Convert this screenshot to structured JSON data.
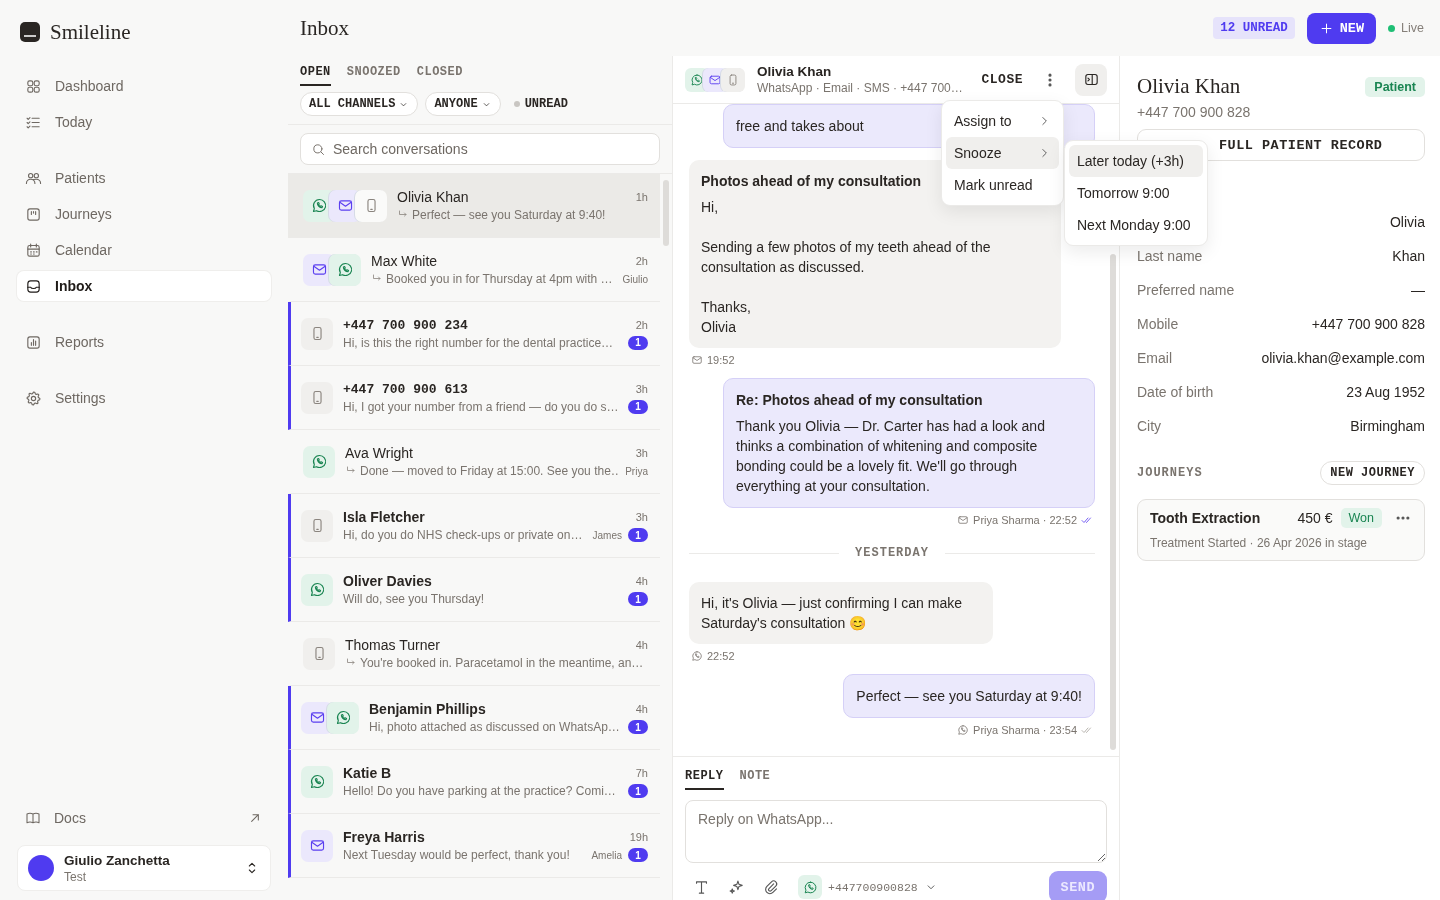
{
  "sidebar": {
    "brand": "Smileline",
    "nav_groups": [
      {
        "items": [
          {
            "label": "Dashboard",
            "selected": false
          },
          {
            "label": "Today",
            "selected": false
          }
        ]
      },
      {
        "items": [
          {
            "label": "Patients",
            "selected": false
          },
          {
            "label": "Journeys",
            "selected": false
          },
          {
            "label": "Calendar",
            "selected": false
          },
          {
            "label": "Inbox",
            "selected": true
          }
        ]
      },
      {
        "items": [
          {
            "label": "Reports",
            "selected": false
          }
        ]
      },
      {
        "items": [
          {
            "label": "Settings",
            "selected": false
          }
        ]
      }
    ],
    "docs": "Docs",
    "user": {
      "name": "Giulio Zanchetta",
      "workspace": "Test"
    }
  },
  "header": {
    "title": "Inbox",
    "unread_badge": "12 UNREAD",
    "new_button": "NEW",
    "status": "Live"
  },
  "list": {
    "tabs": [
      {
        "label": "OPEN",
        "selected": true
      },
      {
        "label": "SNOOZED",
        "selected": false
      },
      {
        "label": "CLOSED",
        "selected": false
      }
    ],
    "filters": [
      {
        "label": "ALL CHANNELS",
        "kind": "dropdown"
      },
      {
        "label": "ANYONE",
        "kind": "dropdown"
      },
      {
        "label": "UNREAD",
        "kind": "toggle",
        "on": false
      }
    ],
    "search": {
      "placeholder": "Search conversations"
    },
    "conversations": [
      {
        "channels": [
          {
            "kind": "whatsapp"
          },
          {
            "kind": "email"
          },
          {
            "kind": "sms"
          }
        ],
        "name": "Olivia Khan",
        "phone_name": false,
        "replied": true,
        "preview": "Perfect — see you Saturday at 9:40!",
        "time": "1h",
        "unread": false,
        "selected": true
      },
      {
        "channels": [
          {
            "kind": "email"
          },
          {
            "kind": "whatsapp"
          }
        ],
        "name": "Max White",
        "phone_name": false,
        "replied": true,
        "preview": "Booked you in for Thursday at 4pm with …",
        "time": "2h",
        "assignee": "Giulio",
        "unread": false,
        "selected": false
      },
      {
        "channels": [
          {
            "kind": "sms"
          }
        ],
        "name": "+447 700 900 234",
        "phone_name": true,
        "replied": false,
        "preview": "Hi, is this the right number for the dental practice…",
        "time": "2h",
        "unread_count": "1",
        "unread": true,
        "selected": false
      },
      {
        "channels": [
          {
            "kind": "sms"
          }
        ],
        "name": "+447 700 900 613",
        "phone_name": true,
        "replied": false,
        "preview": "Hi, I got your number from a friend — do you do s…",
        "time": "3h",
        "unread_count": "1",
        "unread": true,
        "selected": false
      },
      {
        "channels": [
          {
            "kind": "whatsapp"
          }
        ],
        "name": "Ava Wright",
        "phone_name": false,
        "replied": true,
        "preview": "Done — moved to Friday at 15:00. See you the…",
        "time": "3h",
        "assignee": "Priya",
        "unread": false,
        "selected": false
      },
      {
        "channels": [
          {
            "kind": "sms"
          }
        ],
        "name": "Isla Fletcher",
        "phone_name": false,
        "replied": false,
        "preview": "Hi, do you do NHS check-ups or private on…",
        "time": "3h",
        "assignee": "James",
        "unread_count": "1",
        "unread": true,
        "selected": false
      },
      {
        "channels": [
          {
            "kind": "whatsapp"
          }
        ],
        "name": "Oliver Davies",
        "phone_name": false,
        "replied": false,
        "preview": "Will do, see you Thursday!",
        "time": "4h",
        "unread_count": "1",
        "unread": true,
        "selected": false
      },
      {
        "channels": [
          {
            "kind": "sms"
          }
        ],
        "name": "Thomas Turner",
        "phone_name": false,
        "replied": true,
        "preview": "You're booked in. Paracetamol in the meantime, an…",
        "time": "4h",
        "unread": false,
        "selected": false
      },
      {
        "channels": [
          {
            "kind": "email"
          },
          {
            "kind": "whatsapp"
          }
        ],
        "name": "Benjamin Phillips",
        "phone_name": false,
        "replied": false,
        "preview": "Hi, photo attached as discussed on WhatsAp…",
        "time": "4h",
        "unread_count": "1",
        "unread": true,
        "selected": false
      },
      {
        "channels": [
          {
            "kind": "whatsapp"
          }
        ],
        "name": "Katie B",
        "phone_name": false,
        "replied": false,
        "preview": "Hello! Do you have parking at the practice? Comi…",
        "time": "7h",
        "unread_count": "1",
        "unread": true,
        "selected": false
      },
      {
        "channels": [
          {
            "kind": "email"
          }
        ],
        "name": "Freya Harris",
        "phone_name": false,
        "replied": false,
        "preview": "Next Tuesday would be perfect, thank you!",
        "time": "19h",
        "assignee": "Amelia",
        "unread_count": "1",
        "unread": true,
        "selected": false
      }
    ]
  },
  "chat": {
    "channels": [
      {
        "kind": "whatsapp"
      },
      {
        "kind": "email"
      },
      {
        "kind": "sms"
      }
    ],
    "name": "Olivia Khan",
    "subtitle": "WhatsApp · Email · SMS · +447 700…",
    "close_button": "CLOSE",
    "messages": [
      {
        "kind": "out",
        "channel": {
          "kind": "email"
        },
        "body": "free and takes about"
      },
      {
        "kind": "in",
        "channel": {
          "kind": "email"
        },
        "subject": "Photos ahead of my consultation",
        "body": "Hi,\n\nSending a few photos of my teeth ahead of the consultation as discussed.\n\nThanks,\nOlivia",
        "meta": "19:52"
      },
      {
        "kind": "out",
        "channel": {
          "kind": "email"
        },
        "subject": "Re: Photos ahead of my consultation",
        "body": "Thank you Olivia — Dr. Carter has had a look and thinks a combination of whitening and composite bonding could be a lovely fit. We'll go through everything at your consultation.",
        "meta": "Priya Sharma · 22:52",
        "read": true
      },
      {
        "kind": "divider",
        "label": "YESTERDAY"
      },
      {
        "kind": "in",
        "channel": {
          "kind": "whatsapp"
        },
        "body": "Hi, it's Olivia — just confirming I can make Saturday's consultation 😊",
        "meta": "22:52"
      },
      {
        "kind": "out",
        "channel": {
          "kind": "whatsapp"
        },
        "body": "Perfect — see you Saturday at 9:40!",
        "meta": "Priya Sharma · 23:54",
        "read": false
      }
    ],
    "composer": {
      "tabs": [
        {
          "label": "REPLY",
          "selected": true
        },
        {
          "label": "NOTE",
          "selected": false
        }
      ],
      "placeholder": "Reply on WhatsApp...",
      "sender": "+447700900828",
      "send_button": "SEND",
      "send_disabled": true
    }
  },
  "context_menu": {
    "items": [
      {
        "label": "Assign to",
        "submenu": true,
        "selected": false
      },
      {
        "label": "Snooze",
        "submenu": true,
        "selected": true
      },
      {
        "label": "Mark unread",
        "submenu": false,
        "selected": false
      }
    ]
  },
  "snooze_menu": {
    "items": [
      {
        "label": "Later today (+3h)",
        "selected": true
      },
      {
        "label": "Tomorrow 9:00",
        "selected": false
      },
      {
        "label": "Next Monday 9:00",
        "selected": false
      }
    ]
  },
  "patient": {
    "name": "Olivia Khan",
    "tag": "Patient",
    "phone": "+447 700 900 828",
    "record_button": "FULL PATIENT RECORD",
    "fields": [
      {
        "value": "Olivia"
      },
      {
        "label": "Last name",
        "value": "Khan"
      },
      {
        "label": "Preferred name",
        "value": "—"
      },
      {
        "label": "Mobile",
        "value": "+447 700 900 828"
      },
      {
        "label": "Email",
        "value": "olivia.khan@example.com"
      },
      {
        "label": "Date of birth",
        "value": "23 Aug 1952"
      },
      {
        "label": "City",
        "value": "Birmingham"
      }
    ],
    "journeys": {
      "title": "JOURNEYS",
      "new_button": "NEW JOURNEY",
      "items": [
        {
          "name": "Tooth Extraction",
          "amount": "450 €",
          "status": "Won",
          "stage": "Treatment Started · 26 Apr 2026 in stage"
        }
      ]
    }
  }
}
